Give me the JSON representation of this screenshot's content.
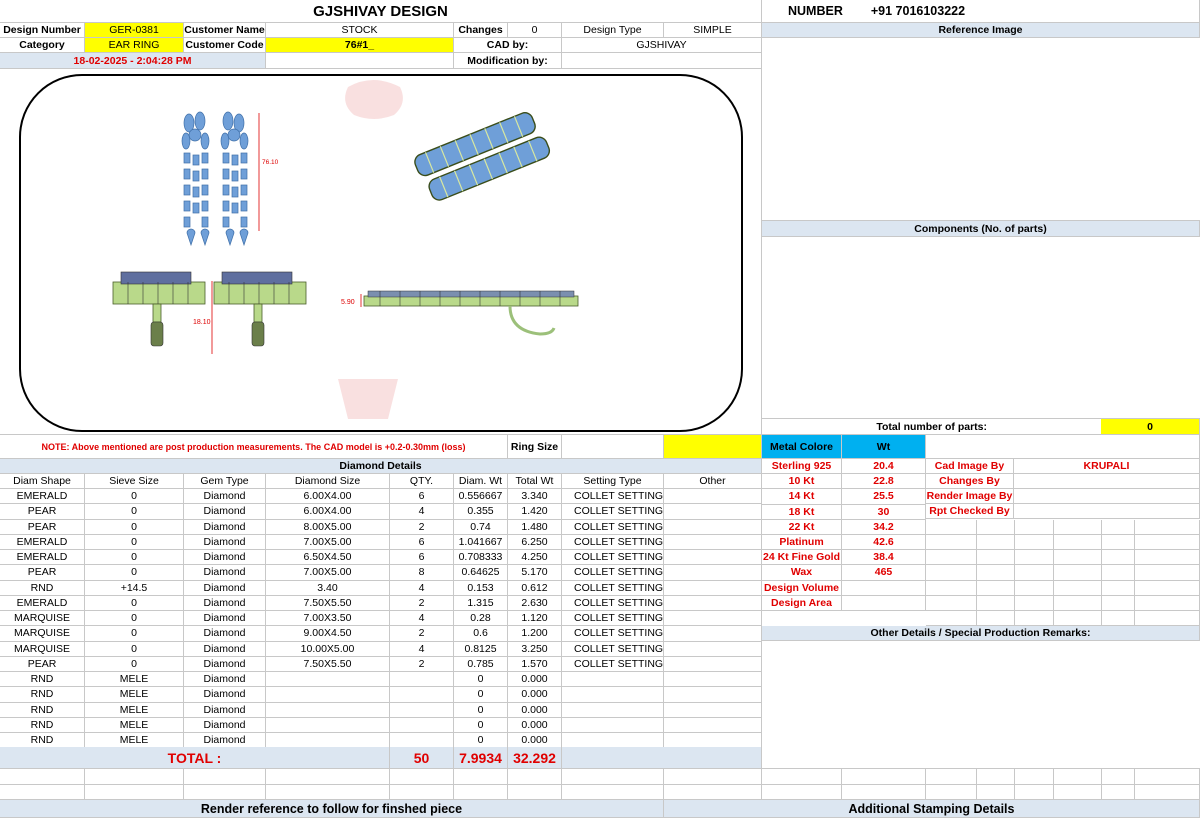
{
  "header": {
    "title": "GJSHIVAY DESIGN",
    "number_label": "NUMBER",
    "number_value": "+91 7016103222"
  },
  "info": {
    "design_number_label": "Design Number",
    "design_number": "GER-0381",
    "customer_name_label": "Customer Name",
    "customer_name": "STOCK",
    "changes_label": "Changes",
    "changes": "0",
    "design_type_label": "Design Type",
    "design_type": "SIMPLE",
    "category_label": "Category",
    "category": "EAR RING",
    "customer_code_label": "Customer Code",
    "customer_code": "76#1_",
    "cad_by_label": "CAD by:",
    "cad_by": "GJSHIVAY",
    "datetime": "18-02-2025 - 2:04:28 PM",
    "modification_label": "Modification by:"
  },
  "right_panel": {
    "reference_image": "Reference Image",
    "components": "Components (No. of parts)",
    "total_parts_label": "Total number of parts:",
    "total_parts": "0",
    "other_details": "Other Details / Special Production Remarks:",
    "stamping": "Additional Stamping Details"
  },
  "drawing": {
    "dim1": "76.10",
    "dim2": "18.10",
    "dim3": "5.90"
  },
  "note": {
    "text": "NOTE: Above mentioned are post production measurements. The CAD model is +0.2-0.30mm (loss)",
    "ring_size_label": "Ring Size"
  },
  "metal": {
    "header_label": "Metal Colore",
    "header_wt": "Wt",
    "rows": [
      {
        "name": "Sterling 925",
        "wt": "20.4"
      },
      {
        "name": "10 Kt",
        "wt": "22.8"
      },
      {
        "name": "14 Kt",
        "wt": "25.5"
      },
      {
        "name": "18 Kt",
        "wt": "30"
      },
      {
        "name": "22 Kt",
        "wt": "34.2"
      },
      {
        "name": "Platinum",
        "wt": "42.6"
      },
      {
        "name": "24 Kt Fine Gold",
        "wt": "38.4"
      },
      {
        "name": "Wax",
        "wt": "465"
      },
      {
        "name": "Design Volume",
        "wt": ""
      },
      {
        "name": "Design Area",
        "wt": ""
      }
    ],
    "cad_image_by_label": "Cad Image By",
    "cad_image_by": "KRUPALI",
    "changes_by_label": "Changes By",
    "render_image_by_label": "Render Image By",
    "rpt_checked_by_label": "Rpt Checked By"
  },
  "diamond": {
    "title": "Diamond Details",
    "columns": [
      "Diam Shape",
      "Sieve Size",
      "Gem Type",
      "Diamond Size",
      "QTY.",
      "Diam. Wt",
      "Total Wt",
      "Setting Type",
      "Other"
    ],
    "rows": [
      [
        "EMERALD",
        "0",
        "Diamond",
        "6.00X4.00",
        "6",
        "0.556667",
        "3.340",
        "COLLET SETTING",
        ""
      ],
      [
        "PEAR",
        "0",
        "Diamond",
        "6.00X4.00",
        "4",
        "0.355",
        "1.420",
        "COLLET SETTING",
        ""
      ],
      [
        "PEAR",
        "0",
        "Diamond",
        "8.00X5.00",
        "2",
        "0.74",
        "1.480",
        "COLLET SETTING",
        ""
      ],
      [
        "EMERALD",
        "0",
        "Diamond",
        "7.00X5.00",
        "6",
        "1.041667",
        "6.250",
        "COLLET SETTING",
        ""
      ],
      [
        "EMERALD",
        "0",
        "Diamond",
        "6.50X4.50",
        "6",
        "0.708333",
        "4.250",
        "COLLET SETTING",
        ""
      ],
      [
        "PEAR",
        "0",
        "Diamond",
        "7.00X5.00",
        "8",
        "0.64625",
        "5.170",
        "COLLET SETTING",
        ""
      ],
      [
        "RND",
        "+14.5",
        "Diamond",
        "3.40",
        "4",
        "0.153",
        "0.612",
        "COLLET SETTING",
        ""
      ],
      [
        "EMERALD",
        "0",
        "Diamond",
        "7.50X5.50",
        "2",
        "1.315",
        "2.630",
        "COLLET SETTING",
        ""
      ],
      [
        "MARQUISE",
        "0",
        "Diamond",
        "7.00X3.50",
        "4",
        "0.28",
        "1.120",
        "COLLET SETTING",
        ""
      ],
      [
        "MARQUISE",
        "0",
        "Diamond",
        "9.00X4.50",
        "2",
        "0.6",
        "1.200",
        "COLLET SETTING",
        ""
      ],
      [
        "MARQUISE",
        "0",
        "Diamond",
        "10.00X5.00",
        "4",
        "0.8125",
        "3.250",
        "COLLET SETTING",
        ""
      ],
      [
        "PEAR",
        "0",
        "Diamond",
        "7.50X5.50",
        "2",
        "0.785",
        "1.570",
        "COLLET SETTING",
        ""
      ],
      [
        "RND",
        "MELE",
        "Diamond",
        "",
        "",
        "0",
        "0.000",
        "",
        ""
      ],
      [
        "RND",
        "MELE",
        "Diamond",
        "",
        "",
        "0",
        "0.000",
        "",
        ""
      ],
      [
        "RND",
        "MELE",
        "Diamond",
        "",
        "",
        "0",
        "0.000",
        "",
        ""
      ],
      [
        "RND",
        "MELE",
        "Diamond",
        "",
        "",
        "0",
        "0.000",
        "",
        ""
      ],
      [
        "RND",
        "MELE",
        "Diamond",
        "",
        "",
        "0",
        "0.000",
        "",
        ""
      ]
    ],
    "total_label": "TOTAL :",
    "total_qty": "50",
    "total_diam_wt": "7.9934",
    "total_wt": "32.292"
  },
  "footer": {
    "render_reference": "Render reference to follow for finshed piece"
  }
}
